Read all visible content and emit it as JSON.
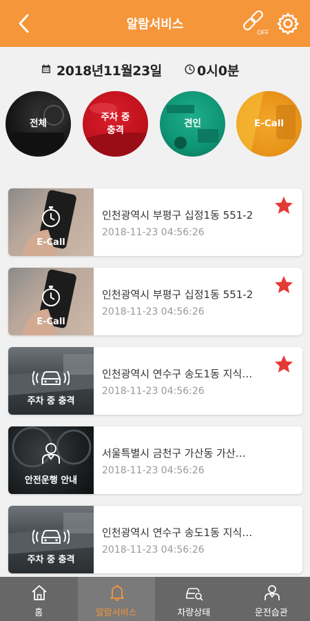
{
  "header": {
    "title": "알람서비스",
    "off_label": "OFF"
  },
  "datebar": {
    "date": "2018년11월23일",
    "time": "0시0분"
  },
  "categories": [
    {
      "label": "전체"
    },
    {
      "label": "주차 중\n충격"
    },
    {
      "label": "견인"
    },
    {
      "label": "E-Call"
    }
  ],
  "alarms": [
    {
      "type": "E-Call",
      "address": "인천광역시 부평구 십정1동 551-2",
      "timestamp": "2018-11-23 04:56:26",
      "starred": true
    },
    {
      "type": "E-Call",
      "address": "인천광역시 부평구 십정1동 551-2",
      "timestamp": "2018-11-23 04:56:26",
      "starred": true
    },
    {
      "type": "주차 중 충격",
      "address": "인천광역시 연수구 송도1동 지식…",
      "timestamp": "2018-11-23 04:56:26",
      "starred": true
    },
    {
      "type": "안전운행 안내",
      "address": "서울특별시 금천구 가산동 가산…",
      "timestamp": "2018-11-23 04:56:26",
      "starred": false
    },
    {
      "type": "주차 중 충격",
      "address": "인천광역시 연수구 송도1동 지식…",
      "timestamp": "2018-11-23 04:56:26",
      "starred": false
    }
  ],
  "tabbar": {
    "items": [
      {
        "label": "홈"
      },
      {
        "label": "알람서비스"
      },
      {
        "label": "차량상태"
      },
      {
        "label": "운전습관"
      }
    ]
  },
  "colors": {
    "accent": "#f5963b",
    "star": "#e53935",
    "tabbar": "#676767"
  }
}
